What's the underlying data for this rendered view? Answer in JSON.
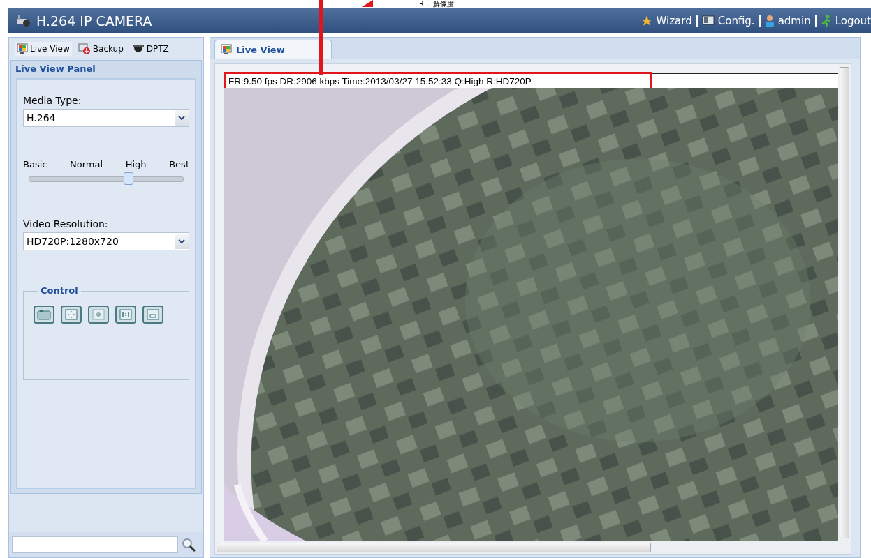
{
  "annotation": {
    "text": "R： 解像度"
  },
  "window": {
    "title": "H.264 IP CAMERA"
  },
  "header_links": [
    {
      "label": "Wizard",
      "kind": "wizard"
    },
    {
      "label": "Config.",
      "kind": "config"
    },
    {
      "label": "admin",
      "kind": "user"
    },
    {
      "label": "Logout",
      "kind": "logout"
    }
  ],
  "sidebar": {
    "tabs": [
      {
        "label": "Live View",
        "kind": "live",
        "selected": true
      },
      {
        "label": "Backup",
        "kind": "backup",
        "selected": false
      },
      {
        "label": "DPTZ",
        "kind": "dptz",
        "selected": false
      }
    ],
    "panel_title": "Live View Panel",
    "media_type": {
      "label": "Media Type:",
      "value": "H.264"
    },
    "quality": {
      "stops": [
        "Basic",
        "Normal",
        "High",
        "Best"
      ],
      "level": 0.65
    },
    "resolution": {
      "label": "Video Resolution:",
      "value": "HD720P:1280x720"
    },
    "control": {
      "title": "Control",
      "buttons": [
        {
          "kind": "snapshot"
        },
        {
          "kind": "fullscreen"
        },
        {
          "kind": "fit"
        },
        {
          "kind": "actual"
        },
        {
          "kind": "window"
        }
      ]
    }
  },
  "main": {
    "tab": {
      "label": "Live View",
      "selected": true
    },
    "status": "FR:9.50 fps  DR:2906 kbps Time:2013/03/27 15:52:33 Q:High R:HD720P"
  }
}
